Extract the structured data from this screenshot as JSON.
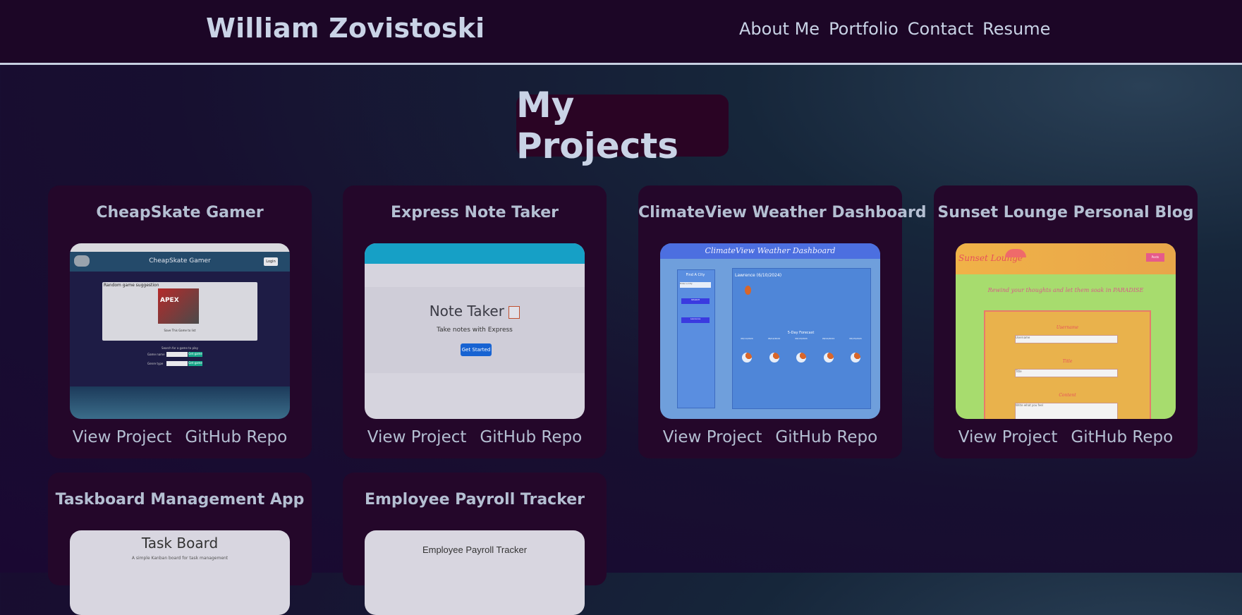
{
  "header": {
    "title": "William Zovistoski",
    "nav": [
      "About Me",
      "Portfolio",
      "Contact",
      "Resume"
    ]
  },
  "main": {
    "heading": "My Projects",
    "link_labels": {
      "view": "View Project",
      "repo": "GitHub Repo"
    },
    "projects": [
      {
        "title": "CheapSkate Gamer",
        "thumb": {
          "app_title": "CheapSkate Gamer",
          "login": "Login",
          "panel_title": "Random game suggestion",
          "game_art": "APEX",
          "caption": "Save This Game to list",
          "search_label": "Search for a game to play",
          "field1": "Game name",
          "field2": "Genre type",
          "btn1": "Get game",
          "btn2": "Get game"
        }
      },
      {
        "title": "Express Note Taker",
        "thumb": {
          "app_title": "Note Taker",
          "subtitle": "Take notes with Express",
          "button": "Get Started"
        }
      },
      {
        "title": "ClimateView Weather Dashboard",
        "thumb": {
          "app_title": "ClimateView Weather Dashboard",
          "find_city": "Find A City",
          "input_placeholder": "Enter a City",
          "search_btn": "SEARCH",
          "history_btn": "Lawrence",
          "current": "Lawrence (6/10/2024)",
          "forecast_title": "5-Day Forecast",
          "dates": [
            "06/11/2024",
            "06/12/2024",
            "06/13/2024",
            "06/14/2024",
            "06/15/2024"
          ]
        }
      },
      {
        "title": "Sunset Lounge Personal Blog",
        "thumb": {
          "brand": "Sunset Lounge",
          "nav_btn": "Posts",
          "tagline": "Rewind your thoughts and let them soak in PARADISE",
          "label_user": "Username",
          "user_value": "Username",
          "label_title": "Title",
          "title_value": "Title",
          "label_content": "Content",
          "content_value": "Write what you feel"
        }
      },
      {
        "title": "Taskboard Management App",
        "thumb": {
          "app_title": "Task Board",
          "subtitle": "A simple Kanban board for task management"
        }
      },
      {
        "title": "Employee Payroll Tracker",
        "thumb": {
          "app_title": "Employee Payroll Tracker"
        }
      }
    ]
  }
}
